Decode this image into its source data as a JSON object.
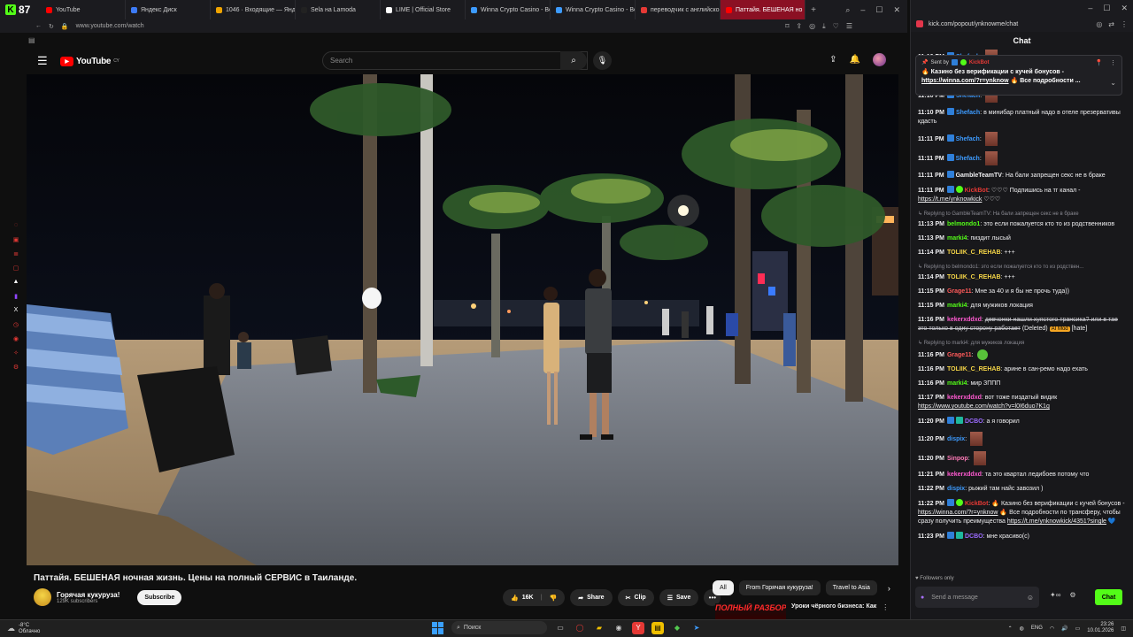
{
  "browser_left": {
    "tab_counter": "87",
    "tabs": [
      {
        "label": "YouTube",
        "color": "#ff0000"
      },
      {
        "label": "Яндекс Диск",
        "color": "#3d7bf6"
      },
      {
        "label": "1046 · Входящие — Яндекс",
        "color": "#f0a400"
      },
      {
        "label": "Sela на Lamoda",
        "color": "#222222"
      },
      {
        "label": "LIME | Official Store",
        "color": "#ffffff"
      },
      {
        "label": "Winna Crypto Casino - Be",
        "color": "#3d9bff"
      },
      {
        "label": "Winna Crypto Casino - Be",
        "color": "#3d9bff"
      },
      {
        "label": "переводчик с английского",
        "color": "#e53935"
      },
      {
        "label": "Паттайя. БЕШЕНАЯ но",
        "color": "#ff0000"
      }
    ],
    "url": "www.youtube.com/watch"
  },
  "youtube": {
    "logo_text": "YouTube",
    "logo_region": "CY",
    "search_placeholder": "Search",
    "video_title": "Паттайя. БЕШЕНАЯ ночная жизнь. Цены на полный СЕРВИС в Таиланде.",
    "channel_name": "Горячая кукуруза!",
    "subscribers": "129K subscribers",
    "subscribe_label": "Subscribe",
    "like_count": "16K",
    "share_label": "Share",
    "clip_label": "Clip",
    "save_label": "Save",
    "chips": [
      "All",
      "From Горячая кукуруза!",
      "Travel to Asia"
    ],
    "reco_thumb_text": "ПОЛНЫЙ РАЗБОР",
    "reco_title": "Уроки чёрного бизнеса: Как"
  },
  "chat_window": {
    "url": "kick.com/popout/ynknowme/chat",
    "title": "Chat",
    "pinned": {
      "sent_by_label": "Sent by",
      "sender": "KickBot",
      "text": "🔥 Казино без верификации с кучей бонусов - ",
      "link": "https://winna.com/?r=ynknow",
      "tail": " 🔥 Все подробности ..."
    },
    "messages": [
      {
        "time": "11:10 PM",
        "user": "Shefach",
        "color": "#3d9bff",
        "emote": true
      },
      {
        "time": "11:10 PM",
        "user": "Shefach",
        "color": "#3d9bff",
        "emote": true
      },
      {
        "time": "11:10 PM",
        "user": "Shefach",
        "color": "#3d9bff",
        "emote": true
      },
      {
        "time": "11:10 PM",
        "user": "Shefach",
        "color": "#3d9bff",
        "text": "в минибар платный надо в отеле презервативы кдасть"
      },
      {
        "time": "11:11 PM",
        "user": "Shefach",
        "color": "#3d9bff",
        "emote": true
      },
      {
        "time": "11:11 PM",
        "user": "Shefach",
        "color": "#3d9bff",
        "emote": true
      },
      {
        "time": "11:11 PM",
        "user": "GambleTeamTV",
        "color": "#efeff1",
        "text": "На бали запрещен секс не в браке"
      },
      {
        "time": "11:11 PM",
        "user": "KickBot",
        "color": "#e53935",
        "badge": "green",
        "text": "♡♡♡ Подпишись на тг канал - ",
        "link": "https://t.me/ynknowkick",
        "tail": " ♡♡♡"
      },
      {
        "reply": "Replying to GambleTeamTV: На бали запрещен секс не в браке",
        "time": "11:13 PM",
        "user": "belmondo1",
        "color": "#53fc18",
        "text": "это если пожалуется кто то из родственников",
        "nobadge": true
      },
      {
        "time": "11:13 PM",
        "user": "marki4",
        "color": "#53fc18",
        "text": "пиздит лысый",
        "nobadge": true
      },
      {
        "time": "11:14 PM",
        "user": "TOLIIK_C_REHAB",
        "color": "#f5d547",
        "text": "+++",
        "nobadge": true
      },
      {
        "reply": "Replying to belmondo1: это если пожалуется кто то из родствен...",
        "time": "11:14 PM",
        "user": "TOLIIK_C_REHAB",
        "color": "#f5d547",
        "text": "+++",
        "nobadge": true
      },
      {
        "time": "11:15 PM",
        "user": "Grage11",
        "color": "#ff5a5a",
        "text": "Мне за 40 и я бы не прочь туда))",
        "nobadge": true
      },
      {
        "time": "11:15 PM",
        "user": "marki4",
        "color": "#53fc18",
        "text": "для мужиков локация",
        "nobadge": true
      },
      {
        "time": "11:16 PM",
        "user": "kekerxddxd",
        "color": "#ff5ad1",
        "text": "девчонки нашли хуястого трансика? или в тае это только в одну сторону работает",
        "struck": true,
        "deleted": "(Deleted)",
        "mod": "AI Mod",
        "hate": "[hate]",
        "nobadge": true
      },
      {
        "reply": "Replying to marki4: для мужиков локация",
        "time": "11:16 PM",
        "user": "Grage11",
        "color": "#ff5a5a",
        "emote": "green",
        "nobadge": true
      },
      {
        "time": "11:16 PM",
        "user": "TOLIIK_C_REHAB",
        "color": "#f5d547",
        "text": "арине в сан-ремо надо ехать",
        "nobadge": true
      },
      {
        "time": "11:16 PM",
        "user": "marki4",
        "color": "#53fc18",
        "text": "мир ЗППП",
        "nobadge": true
      },
      {
        "time": "11:17 PM",
        "user": "kekerxddxd",
        "color": "#ff5ad1",
        "text": "вот тоже пиздатый видик ",
        "link": "https://www.youtube.com/watch?v=l0I6duo7K1g",
        "nobadge": true
      },
      {
        "time": "11:20 PM",
        "user": "DCBO",
        "color": "#9b6bff",
        "badge": "teal",
        "text": "а я говорил"
      },
      {
        "time": "11:20 PM",
        "user": "dispix",
        "color": "#3d9bff",
        "emote": true,
        "nobadge": true
      },
      {
        "time": "11:20 PM",
        "user": "Sinpop",
        "color": "#ff7ab8",
        "emote": true,
        "nobadge": true
      },
      {
        "time": "11:21 PM",
        "user": "kekerxddxd",
        "color": "#ff5ad1",
        "text": "та это квартал ледибоев потому что",
        "nobadge": true
      },
      {
        "time": "11:22 PM",
        "user": "dispix",
        "color": "#3d9bff",
        "text": "рыжий там найс завозил )",
        "nobadge": true
      },
      {
        "time": "11:22 PM",
        "user": "KickBot",
        "color": "#e53935",
        "badge": "green",
        "text": "🔥 Казино без верификации с кучей бонусов - ",
        "link": "https://winna.com/?r=ynknow",
        "tail": " 🔥 Все подробности по трансферу, чтобы сразу получить преимущества ",
        "link2": "https://t.me/ynknowkick/4351?single",
        "tail2": " 💙"
      },
      {
        "time": "11:23 PM",
        "user": "DCBO",
        "color": "#9b6bff",
        "badge": "teal",
        "text": "мне красиво(с)"
      }
    ],
    "followers_only": "Followers only",
    "input_placeholder": "Send a message",
    "send_label": "Chat"
  },
  "taskbar": {
    "temperature": "-8°C",
    "weather": "Облачно",
    "search_label": "Поиск",
    "language": "ENG",
    "time": "23:26",
    "date": "10.01.2026"
  }
}
